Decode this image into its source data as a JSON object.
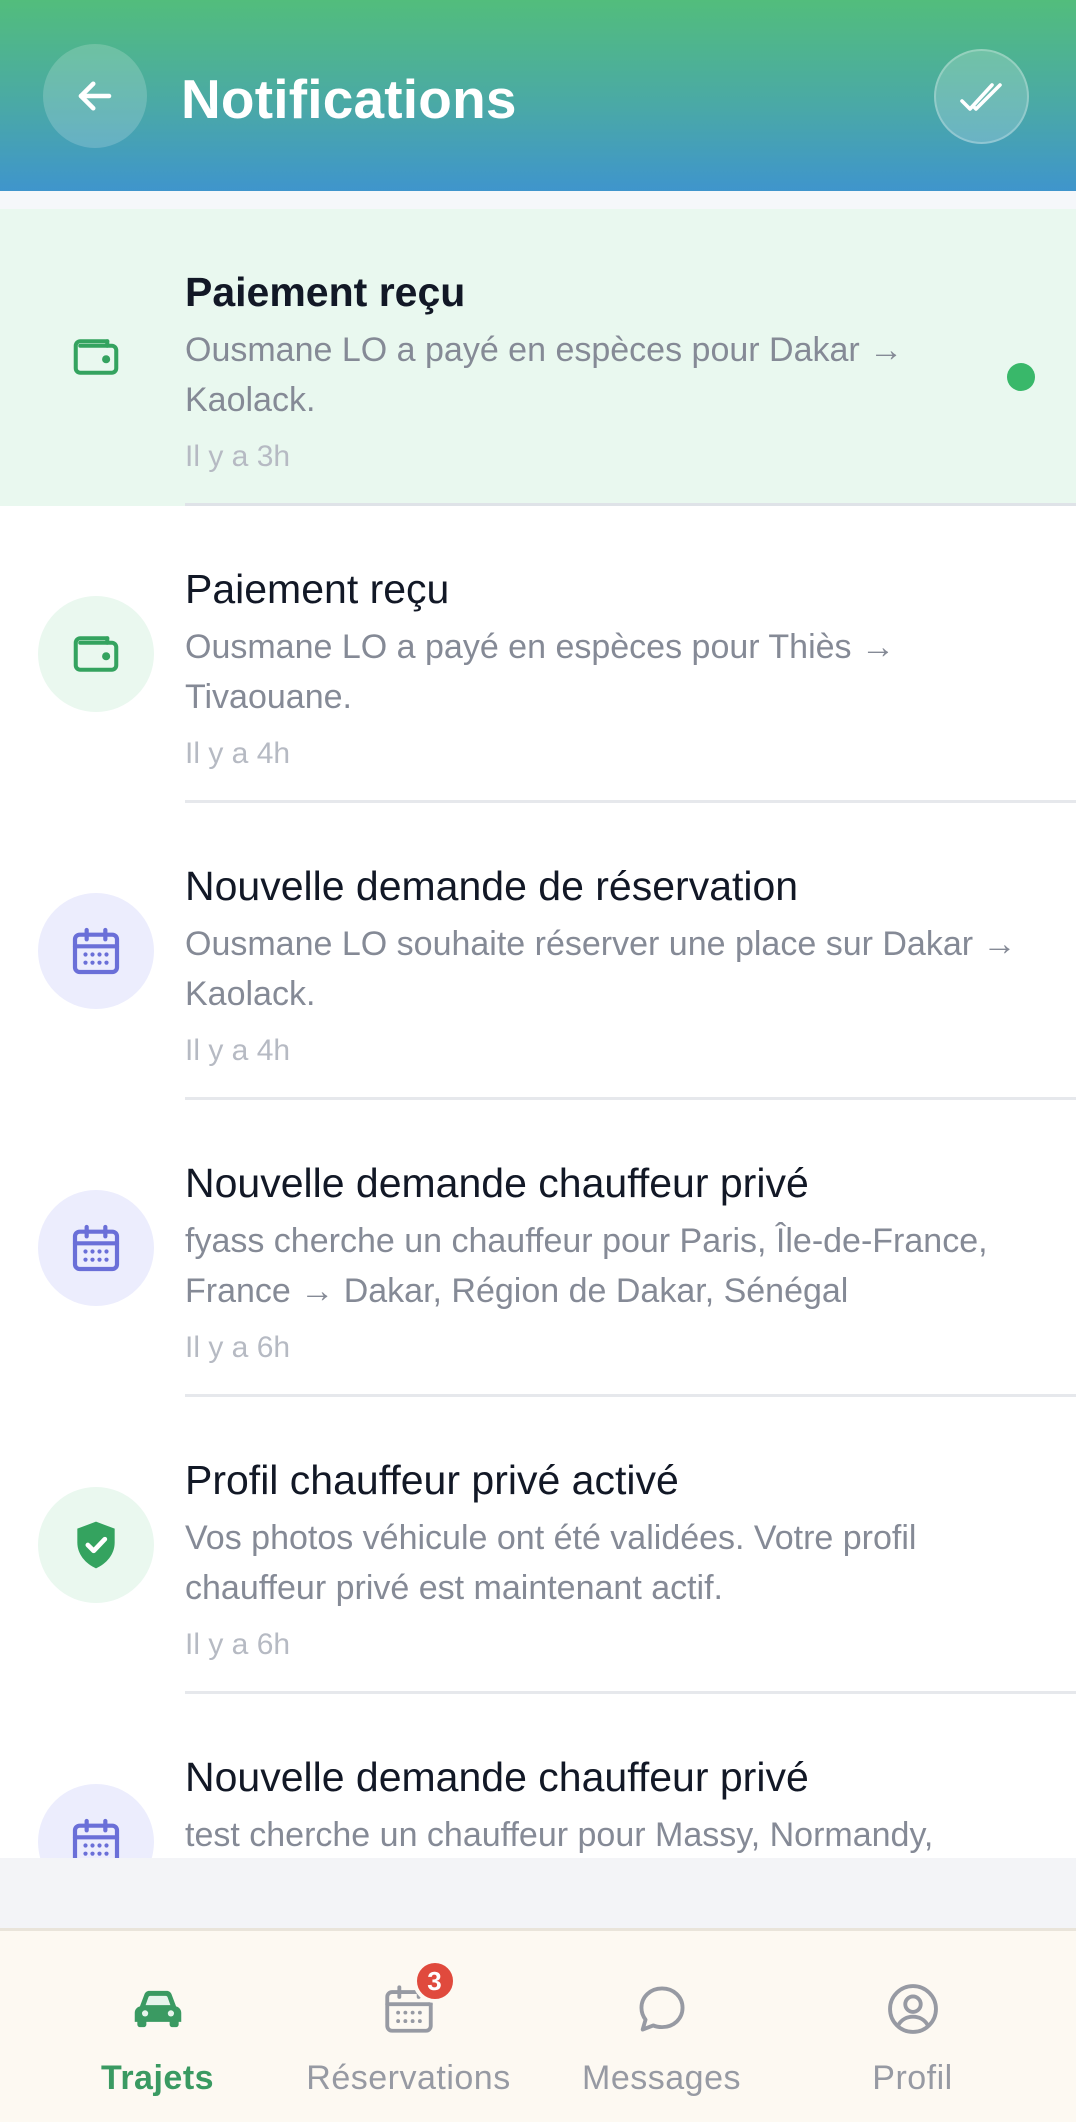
{
  "header": {
    "title": "Notifications",
    "back_icon": "arrow-left-icon",
    "mark_all_read_icon": "double-check-icon"
  },
  "notifications": [
    {
      "title": "Paiement reçu",
      "body": "Ousmane LO a payé en espèces pour Dakar → Kaolack.",
      "time": "Il y a 3h",
      "icon": "wallet-icon",
      "unread": true
    },
    {
      "title": "Paiement reçu",
      "body": "Ousmane LO a payé en espèces pour Thiès → Tivaouane.",
      "time": "Il y a 4h",
      "icon": "wallet-icon",
      "unread": false
    },
    {
      "title": "Nouvelle demande de réservation",
      "body": "Ousmane LO souhaite réserver une place sur Dakar → Kaolack.",
      "time": "Il y a 4h",
      "icon": "calendar-icon",
      "unread": false
    },
    {
      "title": "Nouvelle demande chauffeur privé",
      "body": "fyass cherche un chauffeur pour Paris, Île-de-France, France → Dakar, Région de Dakar, Sénégal",
      "time": "Il y a 6h",
      "icon": "calendar-icon",
      "unread": false
    },
    {
      "title": "Profil chauffeur privé activé",
      "body": "Vos photos véhicule ont été validées. Votre profil chauffeur privé est maintenant actif.",
      "time": "Il y a 6h",
      "icon": "shield-check-icon",
      "unread": false
    },
    {
      "title": "Nouvelle demande chauffeur privé",
      "body": "test cherche un chauffeur pour Massy, Normandy,",
      "time": "",
      "icon": "calendar-icon",
      "unread": false
    }
  ],
  "bottom_nav": {
    "items": [
      {
        "label": "Trajets",
        "icon": "car-icon",
        "active": true
      },
      {
        "label": "Réservations",
        "icon": "calendar-icon",
        "badge": "3",
        "active": false
      },
      {
        "label": "Messages",
        "icon": "chat-bubble-icon",
        "active": false
      },
      {
        "label": "Profil",
        "icon": "user-circle-icon",
        "active": false
      }
    ]
  },
  "colors": {
    "header_gradient_top": "#52bd7c",
    "header_gradient_bottom": "#3f95cc",
    "accent_green": "#3a9a62",
    "unread_bg": "#e9f8ef",
    "badge_red": "#e04a3d",
    "calendar_purple": "#6a6fd8"
  }
}
